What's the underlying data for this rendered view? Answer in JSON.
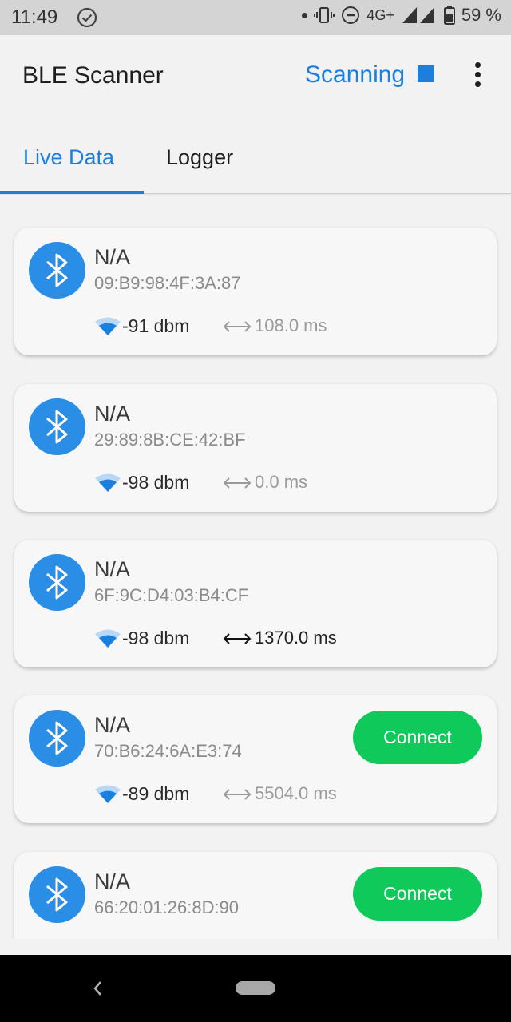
{
  "status_bar": {
    "time": "11:49",
    "network": "4G+",
    "battery": "59 %"
  },
  "app_bar": {
    "title": "BLE Scanner",
    "scanning_label": "Scanning",
    "accent_color": "#1a80e0"
  },
  "tabs": [
    {
      "label": "Live Data",
      "active": true
    },
    {
      "label": "Logger",
      "active": false
    }
  ],
  "devices": [
    {
      "name": "N/A",
      "mac": "09:B9:98:4F:3A:87",
      "rssi": "-91 dbm",
      "interval": "108.0 ms"
    },
    {
      "name": "N/A",
      "mac": "29:89:8B:CE:42:BF",
      "rssi": "-98 dbm",
      "interval": "0.0 ms"
    },
    {
      "name": "N/A",
      "mac": "6F:9C:D4:03:B4:CF",
      "rssi": "-98 dbm",
      "interval": "1370.0 ms"
    },
    {
      "name": "N/A",
      "mac": "70:B6:24:6A:E3:74",
      "rssi": "-89 dbm",
      "interval": "5504.0 ms",
      "connect_label": "Connect"
    },
    {
      "name": "N/A",
      "mac": "66:20:01:26:8D:90",
      "connect_label": "Connect"
    }
  ],
  "icons": {
    "status_check": "check-circle-icon",
    "device": "bluetooth-icon",
    "signal": "wifi-signal-icon",
    "interval": "double-arrow-icon",
    "menu": "more-vert-icon"
  },
  "colors": {
    "connect_button": "#0fc95a",
    "bluetooth_circle": "#2a8de6"
  }
}
